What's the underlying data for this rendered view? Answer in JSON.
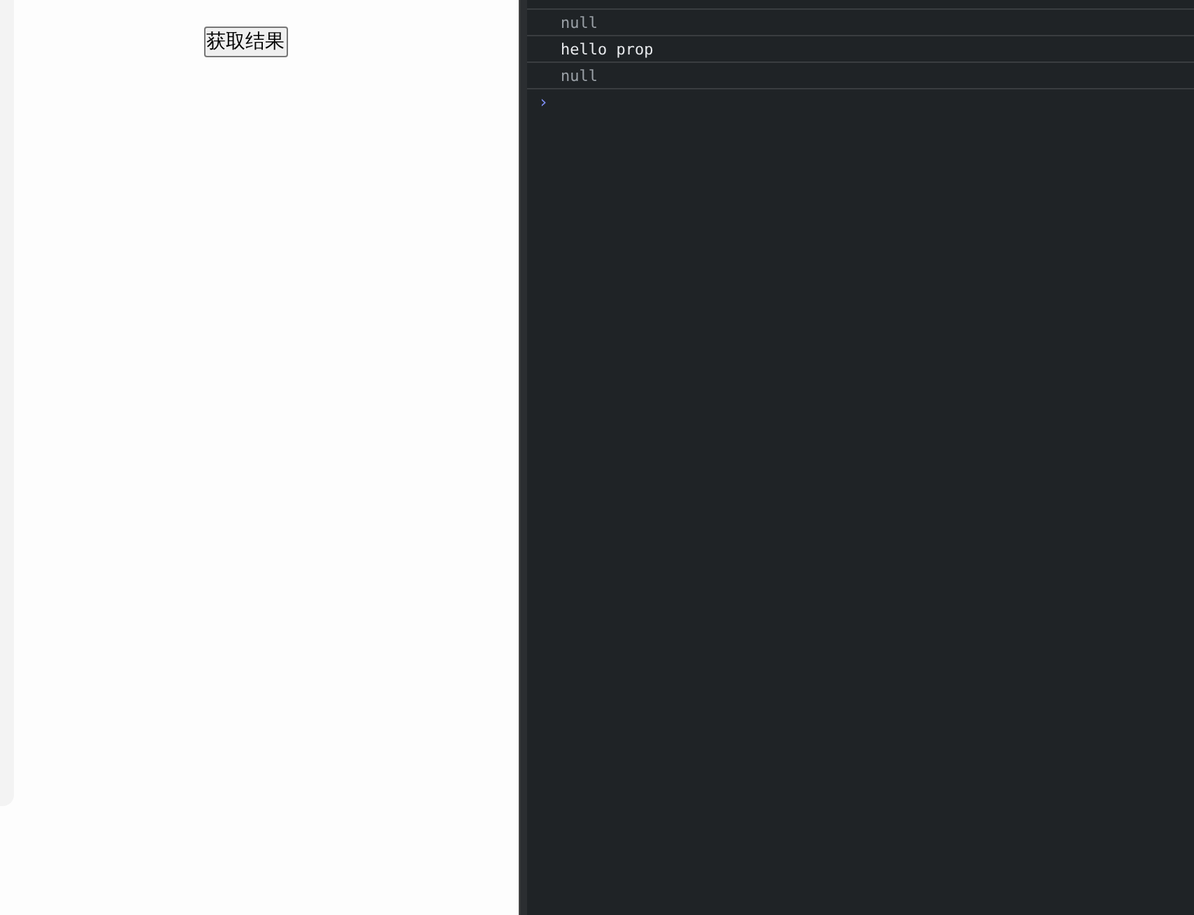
{
  "page": {
    "button": {
      "label": "获取结果"
    }
  },
  "console": {
    "messages": [
      {
        "kind": "null",
        "text": "null"
      },
      {
        "kind": "string",
        "text": "hello prop"
      },
      {
        "kind": "null",
        "text": "null"
      }
    ],
    "prompt": "›"
  }
}
